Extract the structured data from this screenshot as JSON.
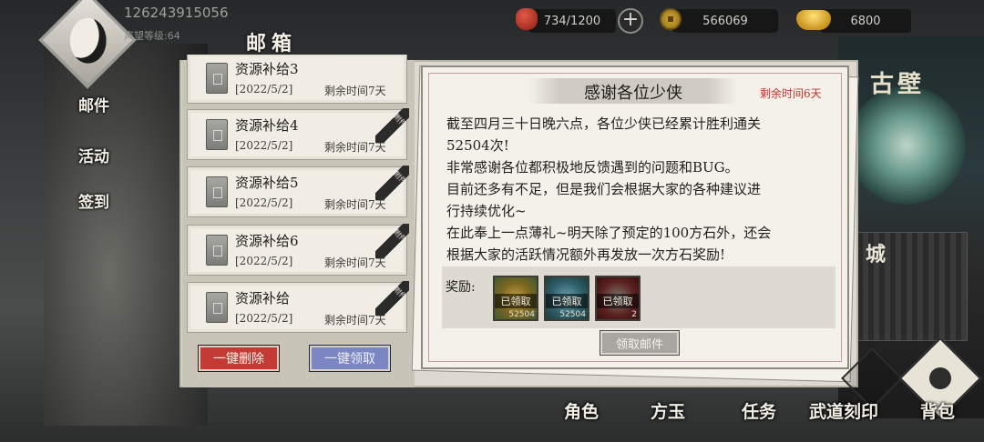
{
  "player": {
    "id": "126243915056",
    "reputation_level": "声望等级:64"
  },
  "resources": {
    "stamina": "734/1200",
    "copper": "566069",
    "gold": "6800",
    "stamina_icon": "jar-icon",
    "copper_icon": "coin-icon",
    "gold_icon": "ingot-icon",
    "add_icon": "plus-icon"
  },
  "side_menu": [
    "邮件",
    "活动",
    "签到"
  ],
  "mail": {
    "title": "邮箱",
    "attach_tag": "附件",
    "items": [
      {
        "name": "资源补给3",
        "date": "[2022/5/2]",
        "remain": "剩余时间7天"
      },
      {
        "name": "资源补给4",
        "date": "[2022/5/2]",
        "remain": "剩余时间7天"
      },
      {
        "name": "资源补给5",
        "date": "[2022/5/2]",
        "remain": "剩余时间7天"
      },
      {
        "name": "资源补给6",
        "date": "[2022/5/2]",
        "remain": "剩余时间7天"
      },
      {
        "name": "资源补给",
        "date": "[2022/5/2]",
        "remain": "剩余时间7天"
      }
    ],
    "delete_all_label": "一键删除",
    "collect_all_label": "一键领取"
  },
  "letter": {
    "title": "感谢各位少侠",
    "remain": "剩余时间6天",
    "body": [
      "截至四月三十日晚六点，各位少侠已经累计胜利通关",
      "52504次!",
      "非常感谢各位都积极地反馈遇到的问题和BUG。",
      "目前还多有不足，但是我们会根据大家的各种建议进",
      "行持续优化~",
      "在此奉上一点薄礼~明天除了预定的100方石外，还会",
      "根据大家的活跃情况额外再发放一次方石奖励!"
    ],
    "reward_label": "奖励:",
    "rewards": [
      {
        "status": "已领取",
        "qty": "52504"
      },
      {
        "status": "已领取",
        "qty": "52504"
      },
      {
        "status": "已领取",
        "qty": "2"
      }
    ],
    "collect_label": "领取邮件"
  },
  "right_scenes": {
    "wall": "古壁",
    "city": "城"
  },
  "bottom_nav": [
    "角色",
    "方玉",
    "任务",
    "武道刻印",
    "背包"
  ],
  "colors": {
    "accent_red": "#c43a34",
    "accent_blue": "#7b86c2",
    "remain_red": "#c2312c"
  }
}
